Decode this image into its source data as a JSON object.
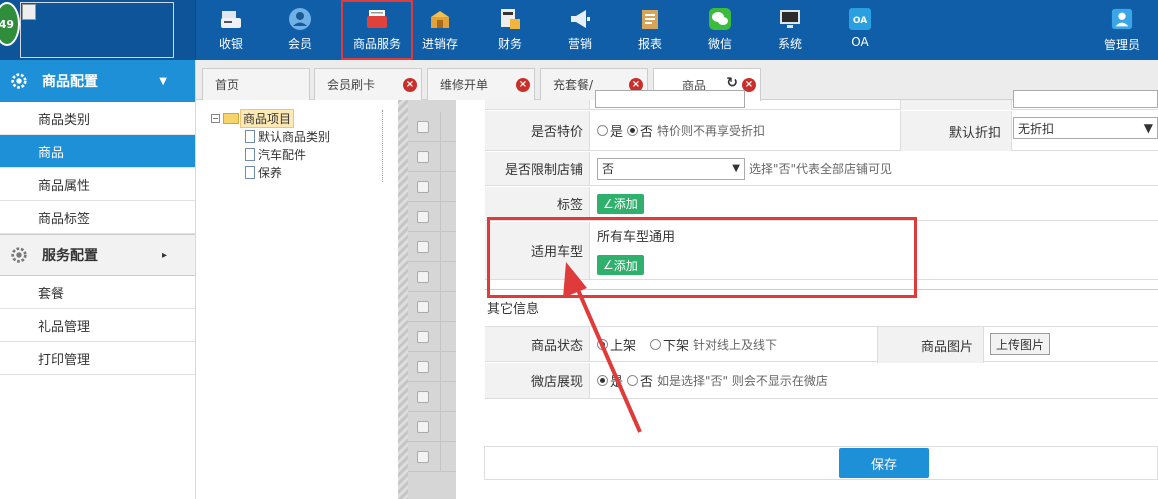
{
  "header": {
    "badge": "49",
    "nav": [
      {
        "label": "收银",
        "icon": "cash-register-icon"
      },
      {
        "label": "会员",
        "icon": "member-icon"
      },
      {
        "label": "商品服务",
        "icon": "product-service-icon"
      },
      {
        "label": "进销存",
        "icon": "inventory-icon"
      },
      {
        "label": "财务",
        "icon": "finance-icon"
      },
      {
        "label": "营销",
        "icon": "megaphone-icon"
      },
      {
        "label": "报表",
        "icon": "report-icon"
      },
      {
        "label": "微信",
        "icon": "wechat-icon"
      },
      {
        "label": "系统",
        "icon": "monitor-icon"
      },
      {
        "label": "OA",
        "icon": "oa-icon"
      }
    ],
    "admin_label": "管理员"
  },
  "sidebar": {
    "section1_title": "商品配置",
    "section1_items": [
      "商品类别",
      "商品",
      "商品属性",
      "商品标签"
    ],
    "section2_title": "服务配置",
    "section2_items": [
      "套餐",
      "礼品管理",
      "打印管理"
    ]
  },
  "tabs": [
    "首页",
    "会员刷卡",
    "维修开单",
    "充套餐/",
    "商品"
  ],
  "tree": {
    "root": "商品项目",
    "children": [
      "默认商品类别",
      "汽车配件",
      "保养"
    ]
  },
  "form": {
    "special_price_label": "是否特价",
    "special_yes": "是",
    "special_no": "否",
    "special_hint": "特价则不再享受折扣",
    "default_discount_label": "默认折扣",
    "default_discount_value": "无折扣",
    "limit_store_label": "是否限制店铺",
    "limit_store_value": "否",
    "limit_store_hint": "选择\"否\"代表全部店铺可见",
    "tag_label": "标签",
    "add_label": "添加",
    "vehicle_label": "适用车型",
    "vehicle_value": "所有车型通用",
    "other_info": "其它信息",
    "status_label": "商品状态",
    "status_on": "上架",
    "status_off": "下架",
    "status_hint": "针对线上及线下",
    "image_label": "商品图片",
    "upload_label": "上传图片",
    "microshop_label": "微店展现",
    "microshop_yes": "是",
    "microshop_no": "否",
    "microshop_hint": "如是选择\"否\" 则会不显示在微店"
  },
  "save_label": "保存",
  "colors": {
    "nav_bg": "#0f5ea7",
    "accent": "#1e90d8",
    "highlight": "#e03b3b",
    "add_btn": "#2fb06c"
  }
}
